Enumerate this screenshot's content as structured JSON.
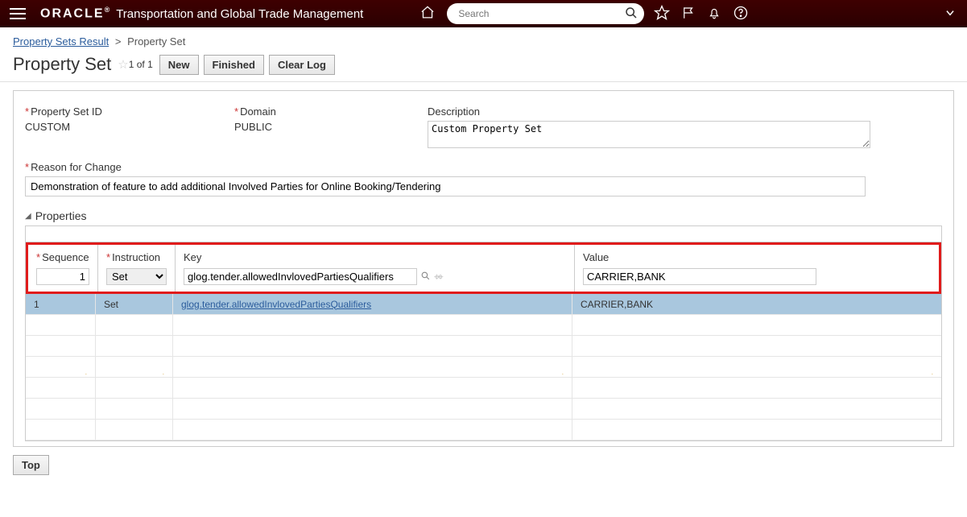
{
  "header": {
    "brand": "ORACLE",
    "app_title": "Transportation and Global Trade Management",
    "search_placeholder": "Search"
  },
  "breadcrumb": {
    "parent": "Property Sets Result",
    "current": "Property Set"
  },
  "titlebar": {
    "title": "Property Set",
    "counter": "1 of 1",
    "new_btn": "New",
    "finished_btn": "Finished",
    "clearlog_btn": "Clear Log"
  },
  "form": {
    "psid_lbl": "Property Set ID",
    "psid_val": "CUSTOM",
    "domain_lbl": "Domain",
    "domain_val": "PUBLIC",
    "desc_lbl": "Description",
    "desc_val": "Custom Property Set",
    "reason_lbl": "Reason for Change",
    "reason_val": "Demonstration of feature to add additional Involved Parties for Online Booking/Tendering"
  },
  "grid": {
    "section_title": "Properties",
    "headers": {
      "seq": "Sequence",
      "inst": "Instruction",
      "key": "Key",
      "val": "Value"
    },
    "input_row": {
      "seq": "1",
      "inst": "Set",
      "key": "glog.tender.allowedInvlovedPartiesQualifiers",
      "val": "CARRIER,BANK"
    },
    "rows": [
      {
        "seq": "1",
        "inst": "Set",
        "key": "glog.tender.allowedInvlovedPartiesQualifiers",
        "val": "CARRIER,BANK",
        "selected": true
      }
    ]
  },
  "footer": {
    "top_btn": "Top"
  }
}
